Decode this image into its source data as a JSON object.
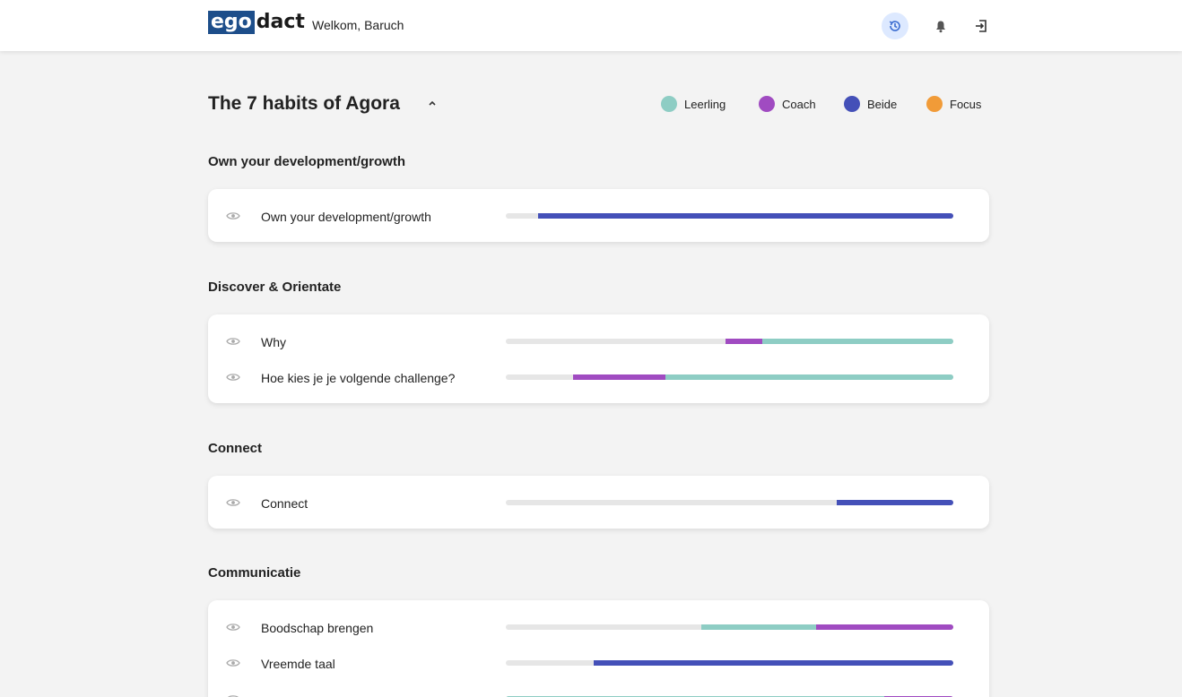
{
  "app": {
    "logo_left": "ego",
    "logo_right": "dact",
    "welcome": "Welkom, Baruch",
    "icons": [
      "history-icon",
      "bell-icon",
      "logout-icon"
    ]
  },
  "page": {
    "title": "The 7 habits of Agora"
  },
  "legend": [
    {
      "label": "Leerling",
      "color": "#8ecdc4"
    },
    {
      "label": "Coach",
      "color": "#a04bc1"
    },
    {
      "label": "Beide",
      "color": "#4450b8"
    },
    {
      "label": "Focus",
      "color": "#f19b38"
    }
  ],
  "sections": [
    {
      "title": "Own your development/growth",
      "rows": [
        {
          "label": "Own your development/growth",
          "segments": [
            {
              "from": 0.072,
              "to": 1.0,
              "color": "#4450b8"
            }
          ]
        }
      ]
    },
    {
      "title": "Discover & Orientate",
      "rows": [
        {
          "label": "Why",
          "segments": [
            {
              "from": 0.49,
              "to": 0.574,
              "color": "#a04bc1"
            },
            {
              "from": 0.574,
              "to": 1.0,
              "color": "#8ecdc4"
            }
          ]
        },
        {
          "label": "Hoe kies je je volgende challenge?",
          "segments": [
            {
              "from": 0.15,
              "to": 0.357,
              "color": "#a04bc1"
            },
            {
              "from": 0.357,
              "to": 1.0,
              "color": "#8ecdc4"
            }
          ]
        }
      ]
    },
    {
      "title": "Connect",
      "rows": [
        {
          "label": "Connect",
          "segments": [
            {
              "from": 0.74,
              "to": 1.0,
              "color": "#4450b8"
            }
          ]
        }
      ]
    },
    {
      "title": "Communicatie",
      "rows": [
        {
          "label": "Boodschap brengen",
          "segments": [
            {
              "from": 0.437,
              "to": 0.694,
              "color": "#8ecdc4"
            },
            {
              "from": 0.694,
              "to": 1.0,
              "color": "#a04bc1"
            }
          ]
        },
        {
          "label": "Vreemde taal",
          "segments": [
            {
              "from": 0.196,
              "to": 1.0,
              "color": "#4450b8"
            }
          ]
        },
        {
          "label": "",
          "segments": [
            {
              "from": 0.0,
              "to": 0.845,
              "color": "#8ecdc4"
            },
            {
              "from": 0.845,
              "to": 1.0,
              "color": "#a04bc1"
            }
          ]
        }
      ]
    }
  ]
}
